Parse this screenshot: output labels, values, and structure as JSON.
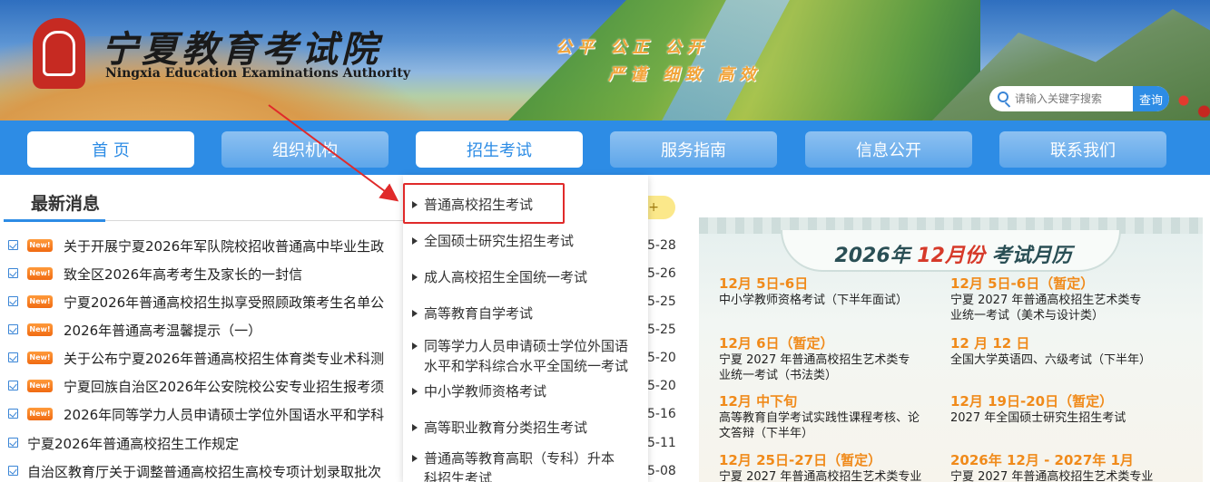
{
  "header": {
    "brand_cn": "宁夏教育考试院",
    "brand_en": "Ningxia Education Examinations Authority",
    "slogan_line1": "公平 公正 公开",
    "slogan_line2": "严谨 细致 高效",
    "search_placeholder": "请输入关键字搜索",
    "search_button": "查询"
  },
  "nav": {
    "items": [
      {
        "label": "首 页",
        "active": true
      },
      {
        "label": "组织机构",
        "active": false
      },
      {
        "label": "招生考试",
        "active": true
      },
      {
        "label": "服务指南",
        "active": false
      },
      {
        "label": "信息公开",
        "active": false
      },
      {
        "label": "联系我们",
        "active": false
      }
    ]
  },
  "news": {
    "title": "最新消息",
    "more_label": "+",
    "items": [
      {
        "text": "关于开展宁夏2026年军队院校招收普通高中毕业生政",
        "date": "5-28",
        "new": true
      },
      {
        "text": "致全区2026年高考考生及家长的一封信",
        "date": "5-26",
        "new": true
      },
      {
        "text": "宁夏2026年普通高校招生拟享受照顾政策考生名单公",
        "date": "5-25",
        "new": true
      },
      {
        "text": "2026年普通高考温馨提示（一）",
        "date": "5-25",
        "new": true
      },
      {
        "text": "关于公布宁夏2026年普通高校招生体育类专业术科测",
        "date": "5-20",
        "new": true
      },
      {
        "text": "宁夏回族自治区2026年公安院校公安专业招生报考须",
        "date": "5-20",
        "new": true
      },
      {
        "text": "2026年同等学力人员申请硕士学位外国语水平和学科",
        "date": "5-16",
        "new": true
      },
      {
        "text": "宁夏2026年普通高校招生工作规定",
        "date": "5-11",
        "new": false
      },
      {
        "text": "自治区教育厅关于调整普通高校招生高校专项计划录取批次",
        "date": "5-08",
        "new": false
      }
    ],
    "badge_text": "New!"
  },
  "dropdown": {
    "items": [
      "普通高校招生考试",
      "全国硕士研究生招生考试",
      "成人高校招生全国统一考试",
      "高等教育自学考试",
      "同等学力人员申请硕士学位外国语水平和学科综合水平全国统一考试",
      "中小学教师资格考试",
      "高等职业教育分类招生考试",
      "普通高等教育高职（专科）升本科招生考试"
    ]
  },
  "calendar": {
    "title_prefix": "2026年",
    "title_month": "12月份",
    "title_suffix": "考试月历",
    "items": [
      {
        "date": "12月 5日-6日",
        "desc": "中小学教师资格考试（下半年面试）"
      },
      {
        "date": "12月 5日-6日（暂定）",
        "desc": "宁夏 2027 年普通高校招生艺术类专业统一考试（美术与设计类）"
      },
      {
        "date": "12月 6日（暂定）",
        "desc": "宁夏 2027 年普通高校招生艺术类专业统一考试（书法类）"
      },
      {
        "date": "12 月 12 日",
        "desc": "全国大学英语四、六级考试（下半年）"
      },
      {
        "date": "12月 中下旬",
        "desc": "高等教育自学考试实践性课程考核、论文答辩（下半年）"
      },
      {
        "date": "12月 19日-20日（暂定）",
        "desc": "2027 年全国硕士研究生招生考试"
      },
      {
        "date": "12月 25日-27日（暂定）",
        "desc": "宁夏 2027 年普通高校招生艺术类专业"
      },
      {
        "date": "2026年 12月 - 2027年 1月",
        "desc": "宁夏 2027 年普通高校招生艺术类专业"
      }
    ]
  },
  "colors": {
    "nav_bg": "#2d8ce5",
    "highlight": "#e02a2a",
    "date_orange": "#f08a1a"
  }
}
